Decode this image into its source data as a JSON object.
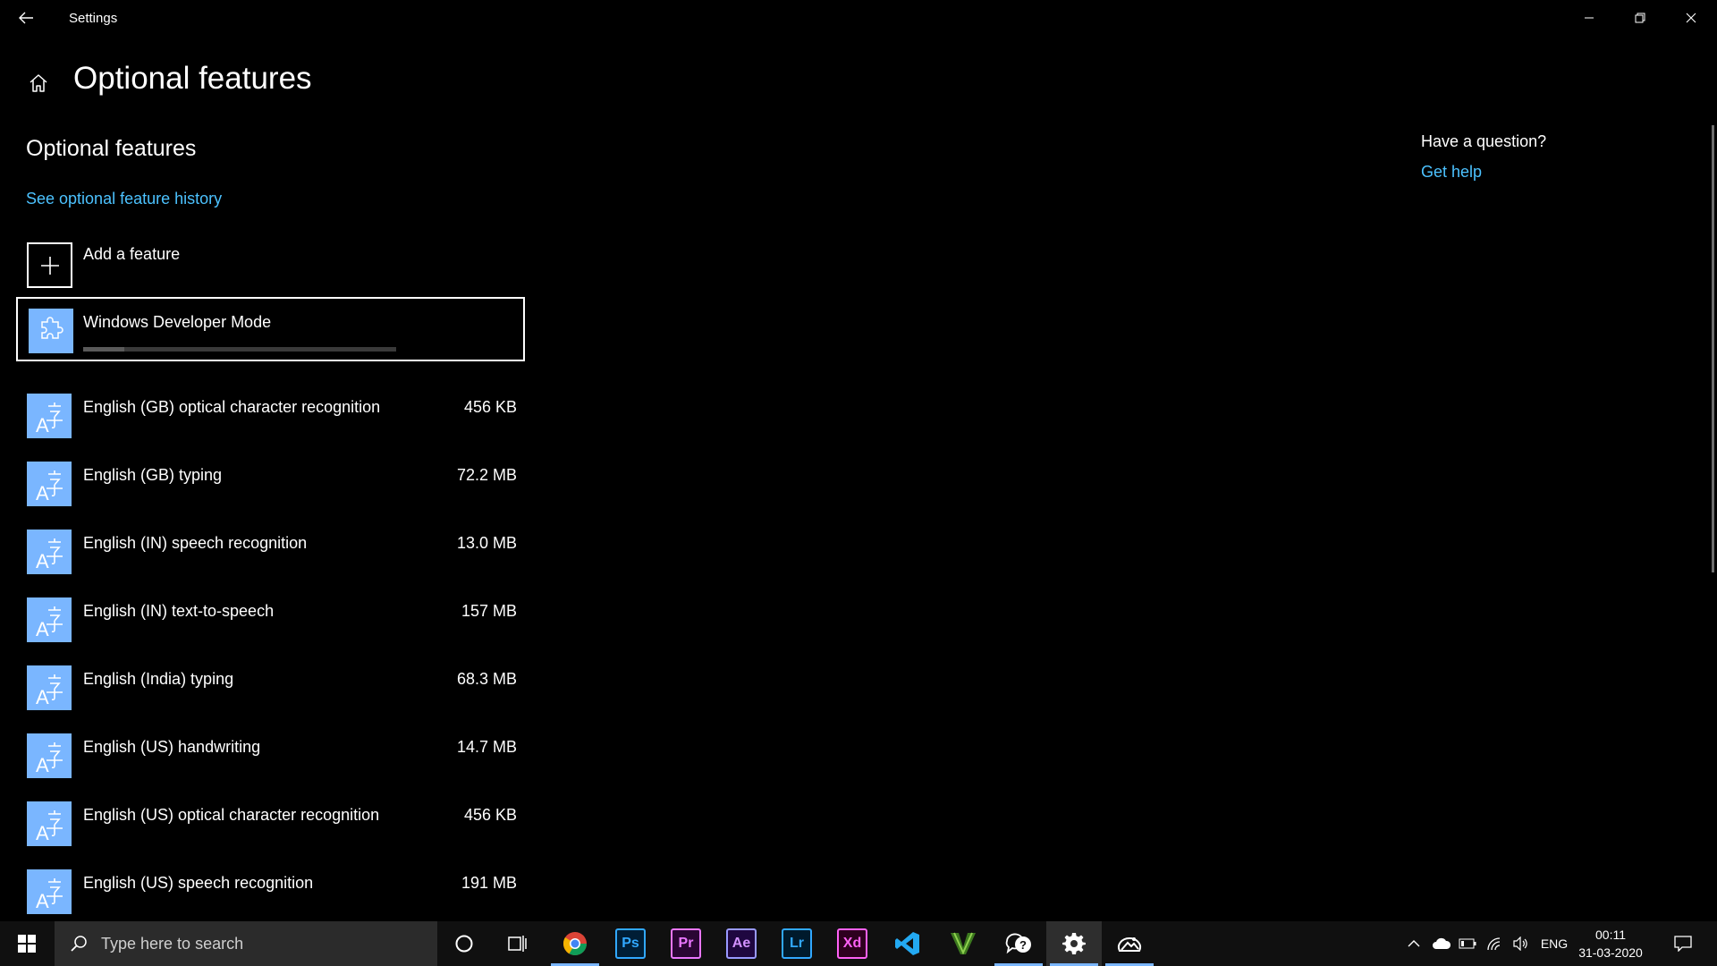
{
  "window": {
    "title": "Settings"
  },
  "page": {
    "title": "Optional features",
    "section_title": "Optional features",
    "history_link": "See optional feature history",
    "add_feature_label": "Add a feature"
  },
  "installing": {
    "name": "Windows Developer Mode",
    "progress": 0.13
  },
  "features": [
    {
      "name": "English (GB) optical character recognition",
      "size": "456 KB"
    },
    {
      "name": "English (GB) typing",
      "size": "72.2 MB"
    },
    {
      "name": "English (IN) speech recognition",
      "size": "13.0 MB"
    },
    {
      "name": "English (IN) text-to-speech",
      "size": "157 MB"
    },
    {
      "name": "English (India) typing",
      "size": "68.3 MB"
    },
    {
      "name": "English (US) handwriting",
      "size": "14.7 MB"
    },
    {
      "name": "English (US) optical character recognition",
      "size": "456 KB"
    },
    {
      "name": "English (US) speech recognition",
      "size": "191 MB"
    }
  ],
  "help": {
    "question": "Have a question?",
    "link": "Get help"
  },
  "taskbar": {
    "search_placeholder": "Type here to search",
    "apps": [
      {
        "name": "Chrome",
        "label": ""
      },
      {
        "name": "Photoshop",
        "label": "Ps"
      },
      {
        "name": "Premiere Pro",
        "label": "Pr"
      },
      {
        "name": "After Effects",
        "label": "Ae"
      },
      {
        "name": "Lightroom",
        "label": "Lr"
      },
      {
        "name": "Adobe XD",
        "label": "Xd"
      },
      {
        "name": "Visual Studio Code",
        "label": ""
      },
      {
        "name": "Vectr",
        "label": "V"
      },
      {
        "name": "Feedback Hub",
        "label": ""
      },
      {
        "name": "Settings",
        "label": ""
      },
      {
        "name": "Photos",
        "label": ""
      }
    ],
    "language": "ENG",
    "time": "00:11",
    "date": "31-03-2020"
  },
  "colors": {
    "accent": "#4cc2ff",
    "feature_icon": "#7ab6ff",
    "background": "#000000",
    "taskbar": "#101010"
  }
}
